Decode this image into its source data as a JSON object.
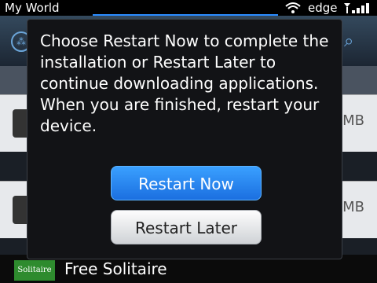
{
  "status_bar": {
    "app_name": "My World",
    "network": "edge"
  },
  "background_list": {
    "rows": [
      {
        "size": "MB"
      },
      {
        "size": "MB"
      }
    ],
    "bottom_item": {
      "icon_text": "Solitaire",
      "name": "Free Solitaire"
    }
  },
  "dialog": {
    "message": "Choose Restart Now to complete the installation or Restart Later to continue downloading applications. When you are finished, restart your device.",
    "restart_now_label": "Restart Now",
    "restart_later_label": "Restart Later"
  },
  "colors": {
    "primary_button": "#1b6fe0",
    "dialog_bg": "#121316",
    "progress_accent": "#2a8cff"
  }
}
